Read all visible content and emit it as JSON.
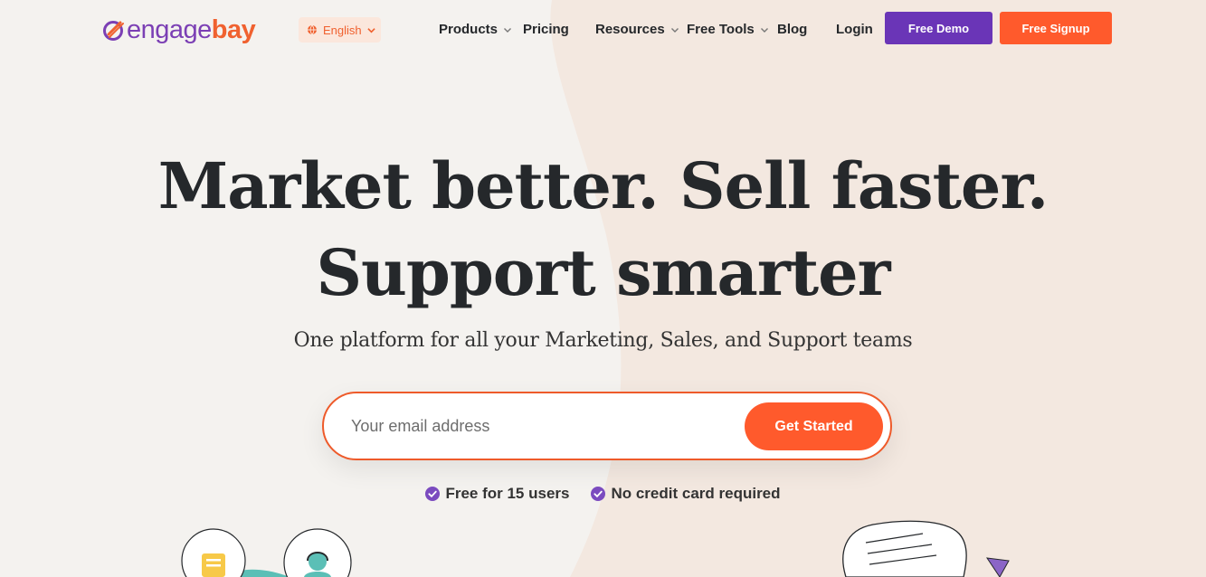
{
  "brand": {
    "name_part1": "engage",
    "name_part2": "bay",
    "colors": {
      "purple": "#6a35b7",
      "orange": "#ff5a2c"
    }
  },
  "language": {
    "label": "English",
    "icon": "globe-icon"
  },
  "nav": {
    "items": [
      {
        "label": "Products",
        "has_dropdown": true
      },
      {
        "label": "Pricing",
        "has_dropdown": false
      },
      {
        "label": "Resources",
        "has_dropdown": true
      },
      {
        "label": "Free Tools",
        "has_dropdown": true
      },
      {
        "label": "Blog",
        "has_dropdown": false
      },
      {
        "label": "Login",
        "has_dropdown": false
      }
    ],
    "demo_label": "Free Demo",
    "signup_label": "Free Signup"
  },
  "hero": {
    "title_line1": "Market better. Sell faster.",
    "title_line2": "Support smarter",
    "subtitle": "One platform for all your Marketing, Sales, and Support teams",
    "email_placeholder": "Your email address",
    "cta_label": "Get Started",
    "perks": [
      "Free for 15 users",
      "No credit card required"
    ]
  }
}
